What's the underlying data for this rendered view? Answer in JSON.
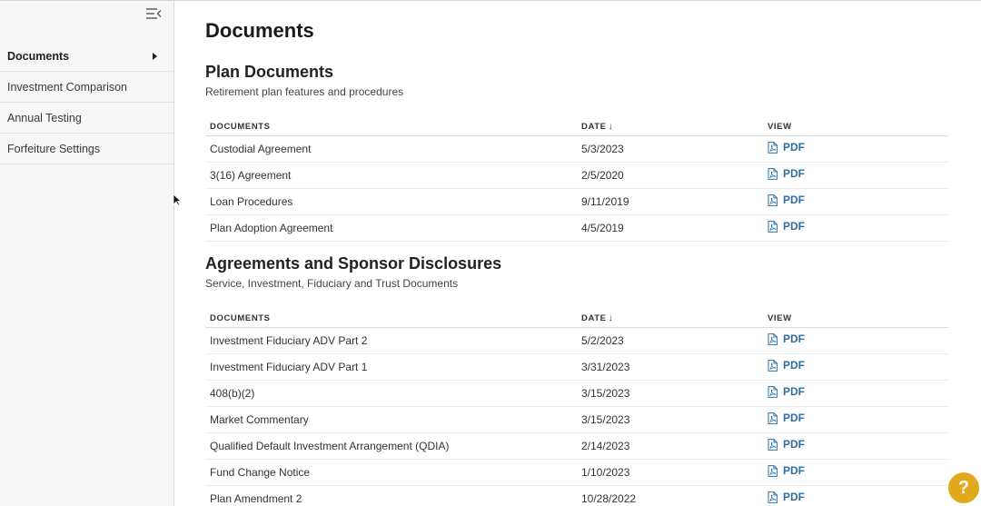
{
  "sidebar": {
    "items": [
      {
        "label": "Documents",
        "active": true
      },
      {
        "label": "Investment Comparison"
      },
      {
        "label": "Annual Testing"
      },
      {
        "label": "Forfeiture Settings"
      }
    ]
  },
  "main": {
    "title": "Documents",
    "sections": [
      {
        "title": "Plan Documents",
        "subtitle": "Retirement plan features and procedures",
        "headers": {
          "documents": "DOCUMENTS",
          "date": "DATE",
          "view": "VIEW"
        },
        "rows": [
          {
            "name": "Custodial Agreement",
            "date": "5/3/2023",
            "view": "PDF"
          },
          {
            "name": "3(16) Agreement",
            "date": "2/5/2020",
            "view": "PDF"
          },
          {
            "name": "Loan Procedures",
            "date": "9/11/2019",
            "view": "PDF"
          },
          {
            "name": "Plan Adoption Agreement",
            "date": "4/5/2019",
            "view": "PDF"
          }
        ]
      },
      {
        "title": "Agreements and Sponsor Disclosures",
        "subtitle": "Service, Investment, Fiduciary and Trust Documents",
        "headers": {
          "documents": "DOCUMENTS",
          "date": "DATE",
          "view": "VIEW"
        },
        "rows": [
          {
            "name": "Investment Fiduciary ADV Part 2",
            "date": "5/2/2023",
            "view": "PDF"
          },
          {
            "name": "Investment Fiduciary ADV Part 1",
            "date": "3/31/2023",
            "view": "PDF"
          },
          {
            "name": "408(b)(2)",
            "date": "3/15/2023",
            "view": "PDF"
          },
          {
            "name": "Market Commentary",
            "date": "3/15/2023",
            "view": "PDF"
          },
          {
            "name": "Qualified Default Investment Arrangement (QDIA)",
            "date": "2/14/2023",
            "view": "PDF"
          },
          {
            "name": "Fund Change Notice",
            "date": "1/10/2023",
            "view": "PDF"
          },
          {
            "name": "Plan Amendment 2",
            "date": "10/28/2022",
            "view": "PDF"
          }
        ]
      }
    ]
  },
  "help": {
    "label": "?"
  },
  "colors": {
    "accent": "#2d6fa3",
    "help": "#e1aa1d"
  },
  "icons": {
    "collapse": "collapse-menu-icon",
    "pdf": "pdf-file-icon",
    "sort": "arrow-down-icon"
  }
}
